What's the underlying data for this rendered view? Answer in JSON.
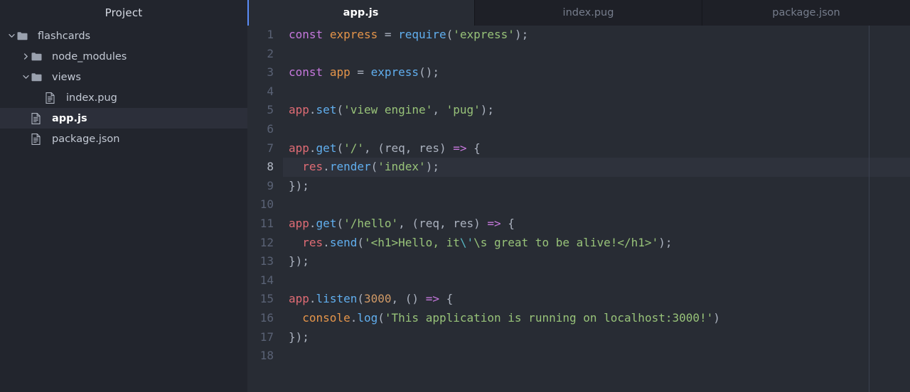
{
  "sidebar": {
    "title": "Project",
    "items": [
      {
        "label": "flashcards",
        "kind": "folder",
        "depth": 0,
        "twisty": "chevron-down-icon",
        "selected": false
      },
      {
        "label": "node_modules",
        "kind": "folder",
        "depth": 1,
        "twisty": "chevron-right-icon",
        "selected": false
      },
      {
        "label": "views",
        "kind": "folder",
        "depth": 1,
        "twisty": "chevron-down-icon",
        "selected": false
      },
      {
        "label": "index.pug",
        "kind": "file",
        "depth": 2,
        "twisty": "none",
        "selected": false
      },
      {
        "label": "app.js",
        "kind": "file",
        "depth": 1,
        "twisty": "none",
        "selected": true
      },
      {
        "label": "package.json",
        "kind": "file",
        "depth": 1,
        "twisty": "none",
        "selected": false
      }
    ]
  },
  "tabs": [
    {
      "label": "app.js",
      "active": true
    },
    {
      "label": "index.pug",
      "active": false
    },
    {
      "label": "package.json",
      "active": false
    }
  ],
  "editor": {
    "current_line": 8,
    "lines": [
      {
        "n": "1",
        "tokens": [
          {
            "t": "const",
            "c": "t-kw"
          },
          {
            "t": " ",
            "c": "t-punc"
          },
          {
            "t": "express",
            "c": "t-var"
          },
          {
            "t": " = ",
            "c": "t-punc"
          },
          {
            "t": "require",
            "c": "t-fn"
          },
          {
            "t": "(",
            "c": "t-punc"
          },
          {
            "t": "'express'",
            "c": "t-str"
          },
          {
            "t": ");",
            "c": "t-punc"
          }
        ]
      },
      {
        "n": "2",
        "tokens": []
      },
      {
        "n": "3",
        "tokens": [
          {
            "t": "const",
            "c": "t-kw"
          },
          {
            "t": " ",
            "c": "t-punc"
          },
          {
            "t": "app",
            "c": "t-var"
          },
          {
            "t": " = ",
            "c": "t-punc"
          },
          {
            "t": "express",
            "c": "t-fn"
          },
          {
            "t": "();",
            "c": "t-punc"
          }
        ]
      },
      {
        "n": "4",
        "tokens": []
      },
      {
        "n": "5",
        "tokens": [
          {
            "t": "app",
            "c": "t-obj"
          },
          {
            "t": ".",
            "c": "t-punc"
          },
          {
            "t": "set",
            "c": "t-fn"
          },
          {
            "t": "(",
            "c": "t-punc"
          },
          {
            "t": "'view engine'",
            "c": "t-str"
          },
          {
            "t": ", ",
            "c": "t-punc"
          },
          {
            "t": "'pug'",
            "c": "t-str"
          },
          {
            "t": ");",
            "c": "t-punc"
          }
        ]
      },
      {
        "n": "6",
        "tokens": []
      },
      {
        "n": "7",
        "tokens": [
          {
            "t": "app",
            "c": "t-obj"
          },
          {
            "t": ".",
            "c": "t-punc"
          },
          {
            "t": "get",
            "c": "t-fn"
          },
          {
            "t": "(",
            "c": "t-punc"
          },
          {
            "t": "'/'",
            "c": "t-str"
          },
          {
            "t": ", (",
            "c": "t-punc"
          },
          {
            "t": "req, res",
            "c": "t-param"
          },
          {
            "t": ") ",
            "c": "t-punc"
          },
          {
            "t": "=>",
            "c": "t-arrow"
          },
          {
            "t": " {",
            "c": "t-punc"
          }
        ]
      },
      {
        "n": "8",
        "tokens": [
          {
            "t": "  ",
            "c": "t-punc"
          },
          {
            "t": "res",
            "c": "t-obj"
          },
          {
            "t": ".",
            "c": "t-punc"
          },
          {
            "t": "render",
            "c": "t-fn"
          },
          {
            "t": "(",
            "c": "t-punc"
          },
          {
            "t": "'index'",
            "c": "t-str"
          },
          {
            "t": ");",
            "c": "t-punc"
          }
        ]
      },
      {
        "n": "9",
        "tokens": [
          {
            "t": "});",
            "c": "t-punc"
          }
        ]
      },
      {
        "n": "10",
        "tokens": []
      },
      {
        "n": "11",
        "tokens": [
          {
            "t": "app",
            "c": "t-obj"
          },
          {
            "t": ".",
            "c": "t-punc"
          },
          {
            "t": "get",
            "c": "t-fn"
          },
          {
            "t": "(",
            "c": "t-punc"
          },
          {
            "t": "'/hello'",
            "c": "t-str"
          },
          {
            "t": ", (",
            "c": "t-punc"
          },
          {
            "t": "req, res",
            "c": "t-param"
          },
          {
            "t": ") ",
            "c": "t-punc"
          },
          {
            "t": "=>",
            "c": "t-arrow"
          },
          {
            "t": " {",
            "c": "t-punc"
          }
        ]
      },
      {
        "n": "12",
        "tokens": [
          {
            "t": "  ",
            "c": "t-punc"
          },
          {
            "t": "res",
            "c": "t-obj"
          },
          {
            "t": ".",
            "c": "t-punc"
          },
          {
            "t": "send",
            "c": "t-fn"
          },
          {
            "t": "(",
            "c": "t-punc"
          },
          {
            "t": "'<h1>Hello, it",
            "c": "t-str"
          },
          {
            "t": "\\'",
            "c": "t-esc"
          },
          {
            "t": "\\s great to be alive!</h1>'",
            "c": "t-str"
          },
          {
            "t": ");",
            "c": "t-punc"
          }
        ]
      },
      {
        "n": "13",
        "tokens": [
          {
            "t": "});",
            "c": "t-punc"
          }
        ]
      },
      {
        "n": "14",
        "tokens": []
      },
      {
        "n": "15",
        "tokens": [
          {
            "t": "app",
            "c": "t-obj"
          },
          {
            "t": ".",
            "c": "t-punc"
          },
          {
            "t": "listen",
            "c": "t-fn"
          },
          {
            "t": "(",
            "c": "t-punc"
          },
          {
            "t": "3000",
            "c": "t-num"
          },
          {
            "t": ", () ",
            "c": "t-punc"
          },
          {
            "t": "=>",
            "c": "t-arrow"
          },
          {
            "t": " {",
            "c": "t-punc"
          }
        ]
      },
      {
        "n": "16",
        "tokens": [
          {
            "t": "  ",
            "c": "t-punc"
          },
          {
            "t": "console",
            "c": "t-var"
          },
          {
            "t": ".",
            "c": "t-punc"
          },
          {
            "t": "log",
            "c": "t-fn"
          },
          {
            "t": "(",
            "c": "t-punc"
          },
          {
            "t": "'This application is running on localhost:3000!'",
            "c": "t-str"
          },
          {
            "t": ")",
            "c": "t-punc"
          }
        ]
      },
      {
        "n": "17",
        "tokens": [
          {
            "t": "});",
            "c": "t-punc"
          }
        ]
      },
      {
        "n": "18",
        "tokens": []
      }
    ]
  },
  "colors": {
    "sidebar_bg": "#22252d",
    "editor_bg": "#282c34",
    "tabbar_bg": "#1e2027",
    "active_tab_accent": "#5b8cf7",
    "selection_bg": "#2c2f3a",
    "current_line_bg": "#2e323c",
    "ruler": "#3b4150",
    "keyword": "#c678dd",
    "string": "#98c379",
    "function": "#61afef",
    "variable": "#e5954a",
    "object": "#e06c75",
    "number": "#d19a66",
    "escape": "#56b6c2",
    "gutter_text": "#5a6275"
  }
}
